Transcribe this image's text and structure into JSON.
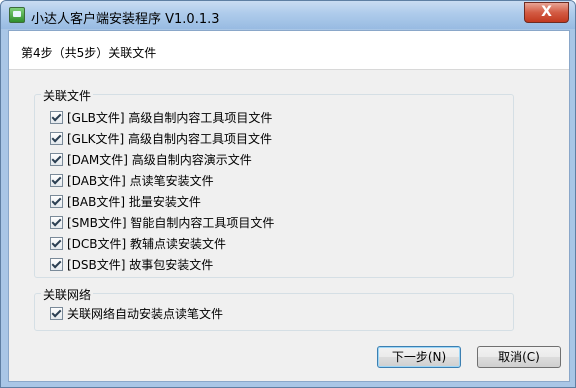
{
  "window": {
    "title": "小达人客户端安装程序 V1.0.1.3",
    "close_glyph": "X",
    "icon": "app-icon"
  },
  "header": {
    "step": "第4步（共5步）关联文件"
  },
  "file_group": {
    "title": "关联文件",
    "items": [
      {
        "label": "[GLB文件] 高级自制内容工具项目文件",
        "checked": true
      },
      {
        "label": "[GLK文件] 高级自制内容工具项目文件",
        "checked": true
      },
      {
        "label": "[DAM文件] 高级自制内容演示文件",
        "checked": true
      },
      {
        "label": "[DAB文件] 点读笔安装文件",
        "checked": true
      },
      {
        "label": "[BAB文件] 批量安装文件",
        "checked": true
      },
      {
        "label": "[SMB文件] 智能自制内容工具项目文件",
        "checked": true
      },
      {
        "label": "[DCB文件] 教辅点读安装文件",
        "checked": true
      },
      {
        "label": "[DSB文件] 故事包安装文件",
        "checked": true
      }
    ]
  },
  "network_group": {
    "title": "关联网络",
    "items": [
      {
        "label": "关联网络自动安装点读笔文件",
        "checked": true
      }
    ]
  },
  "buttons": {
    "next": "下一步(N)",
    "cancel": "取消(C)"
  }
}
